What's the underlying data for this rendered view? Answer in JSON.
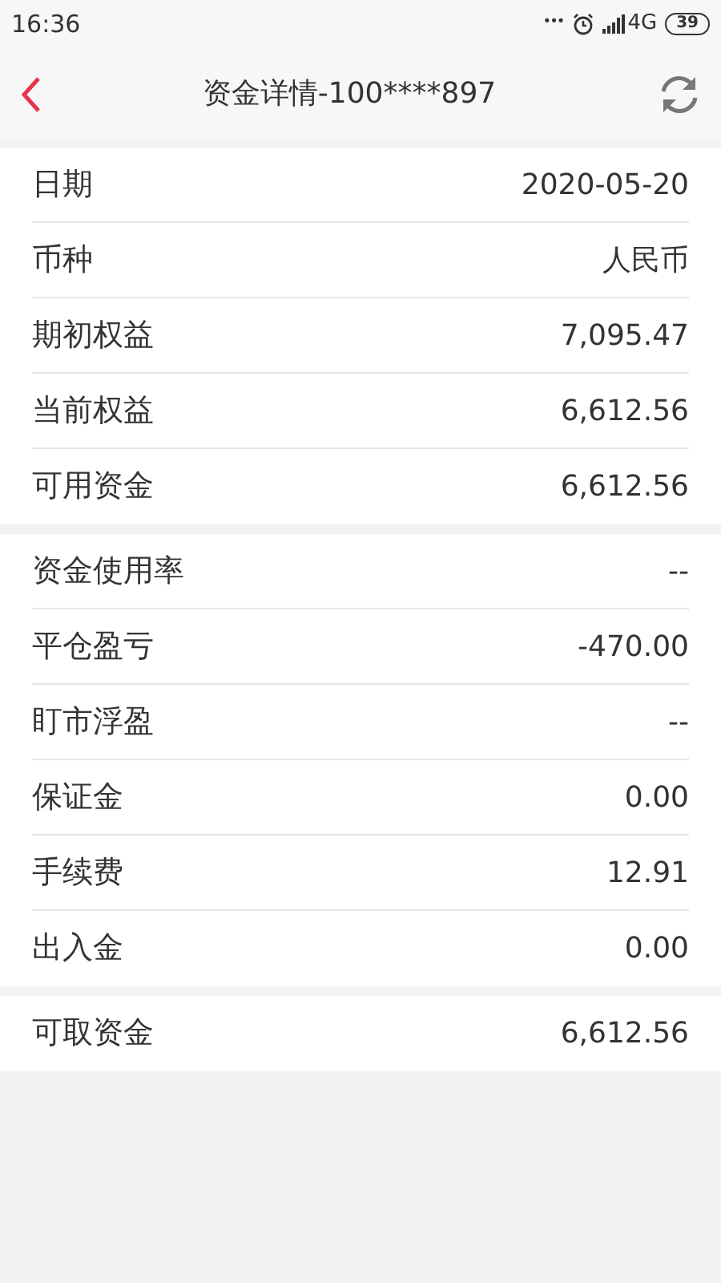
{
  "status_bar": {
    "time": "16:36",
    "more": "•••",
    "network": "4G",
    "battery": "39"
  },
  "header": {
    "title": "资金详情-100****897"
  },
  "sections": [
    [
      {
        "label": "日期",
        "value": "2020-05-20"
      },
      {
        "label": "币种",
        "value": "人民币"
      },
      {
        "label": "期初权益",
        "value": "7,095.47"
      },
      {
        "label": "当前权益",
        "value": "6,612.56"
      },
      {
        "label": "可用资金",
        "value": "6,612.56"
      }
    ],
    [
      {
        "label": "资金使用率",
        "value": "--"
      },
      {
        "label": "平仓盈亏",
        "value": "-470.00"
      },
      {
        "label": "盯市浮盈",
        "value": "--"
      },
      {
        "label": "保证金",
        "value": "0.00"
      },
      {
        "label": "手续费",
        "value": "12.91"
      },
      {
        "label": "出入金",
        "value": "0.00"
      }
    ],
    [
      {
        "label": "可取资金",
        "value": "6,612.56"
      }
    ]
  ]
}
